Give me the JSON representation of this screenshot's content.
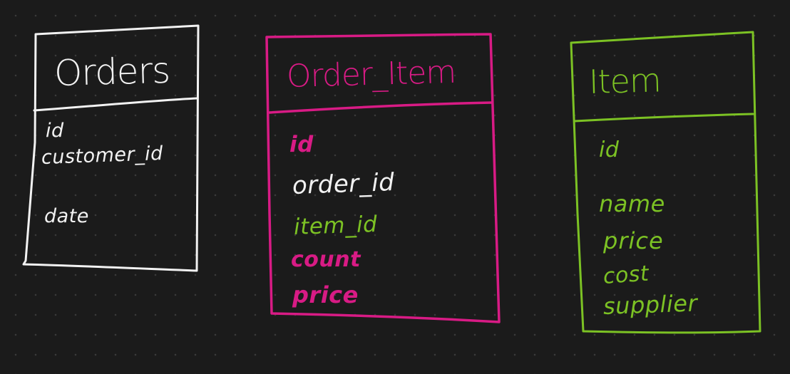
{
  "colors": {
    "background": "#1b1b1b",
    "white": "#f2f2f2",
    "magenta": "#d81b85",
    "green": "#7cc224"
  },
  "tables": [
    {
      "name": "Orders",
      "color": "white",
      "fields": [
        {
          "text": "id",
          "color": "white"
        },
        {
          "text": "customer_id",
          "color": "white"
        },
        {
          "text": "date",
          "color": "white"
        }
      ]
    },
    {
      "name": "Order_Item",
      "color": "magenta",
      "fields": [
        {
          "text": "id",
          "color": "magenta"
        },
        {
          "text": "order_id",
          "color": "white"
        },
        {
          "text": "item_id",
          "color": "green"
        },
        {
          "text": "count",
          "color": "magenta"
        },
        {
          "text": "price",
          "color": "magenta"
        }
      ]
    },
    {
      "name": "Item",
      "color": "green",
      "fields": [
        {
          "text": "id",
          "color": "green"
        },
        {
          "text": "name",
          "color": "green"
        },
        {
          "text": "price",
          "color": "green"
        },
        {
          "text": "cost",
          "color": "green"
        },
        {
          "text": "supplier",
          "color": "green"
        }
      ]
    }
  ]
}
